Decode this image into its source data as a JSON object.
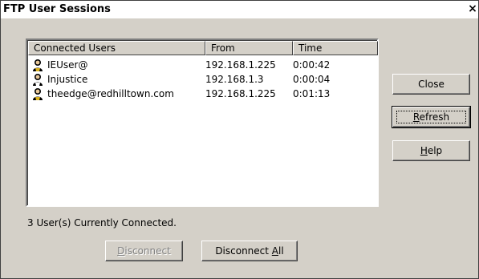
{
  "window": {
    "title": "FTP User Sessions",
    "close_glyph": "×"
  },
  "list": {
    "columns": [
      "Connected Users",
      "From",
      "Time"
    ],
    "rows": [
      {
        "user": "IEUser@",
        "from": "192.168.1.225",
        "time": "0:00:42",
        "icon": "user-icon"
      },
      {
        "user": "Injustice",
        "from": "192.168.1.3",
        "time": "0:00:04",
        "icon": "user-icon"
      },
      {
        "user": "theedge@redhilltown.com",
        "from": "192.168.1.225",
        "time": "0:01:13",
        "icon": "user-icon"
      }
    ]
  },
  "status_text": "3 User(s) Currently Connected.",
  "buttons": {
    "close": "Close",
    "refresh_prefix": "",
    "refresh_mnemonic": "R",
    "refresh_rest": "efresh",
    "help_mnemonic": "H",
    "help_rest": "elp",
    "disconnect_mnemonic": "D",
    "disconnect_rest": "isconnect",
    "disconnect_all_prefix": "Disconnect ",
    "disconnect_all_mnemonic": "A",
    "disconnect_all_rest": "ll"
  }
}
